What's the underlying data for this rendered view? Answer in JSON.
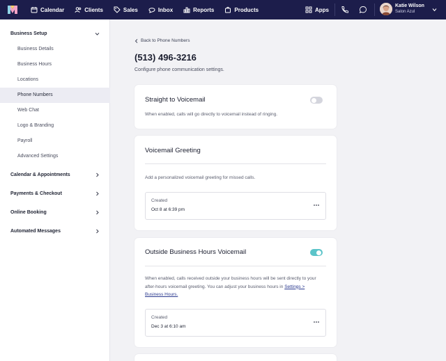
{
  "nav": {
    "items": [
      {
        "label": "Calendar",
        "icon": "calendar-icon"
      },
      {
        "label": "Clients",
        "icon": "clients-icon"
      },
      {
        "label": "Sales",
        "icon": "tag-icon"
      },
      {
        "label": "Inbox",
        "icon": "inbox-icon"
      },
      {
        "label": "Reports",
        "icon": "bar-chart-icon"
      },
      {
        "label": "Products",
        "icon": "bag-icon"
      }
    ],
    "apps_label": "Apps",
    "user": {
      "name": "Katie Wilson",
      "salon": "Salon Azul"
    },
    "brand_color": "#1c1d4b"
  },
  "sidebar": {
    "sections": [
      {
        "label": "Business Setup",
        "expanded": true
      },
      {
        "label": "Calendar & Appointments"
      },
      {
        "label": "Payments & Checkout"
      },
      {
        "label": "Online Booking"
      },
      {
        "label": "Automated Messages"
      }
    ],
    "items": [
      {
        "label": "Business Details"
      },
      {
        "label": "Business Hours"
      },
      {
        "label": "Locations"
      },
      {
        "label": "Phone Numbers",
        "active": true
      },
      {
        "label": "Web Chat"
      },
      {
        "label": "Logo & Branding"
      },
      {
        "label": "Payroll"
      },
      {
        "label": "Advanced Settings"
      }
    ]
  },
  "main": {
    "back_label": "Back to Phone Numbers",
    "title": "(513) 496-3216",
    "subtitle": "Configure phone communication settings."
  },
  "cards": {
    "voicemail": {
      "title": "Straight to Voicemail",
      "text": "When enabled, calls will go directly to voicemail instead of ringing.",
      "enabled": false
    },
    "greeting": {
      "title": "Voicemail Greeting",
      "text": "Add a personalized voicemail greeting for missed calls.",
      "created_label": "Created",
      "created_value": "Oct 8 at 6:39 pm"
    },
    "outside": {
      "title": "Outside Business Hours Voicemail",
      "text": "When enabled, calls received outside your business hours will be sent directly to your after-hours voicemail greeting. You can adjust your business hours in",
      "link": "Settings > Business Hours.",
      "enabled": true,
      "created_label": "Created",
      "created_value": "Dec 3 at 6:10 am"
    }
  }
}
